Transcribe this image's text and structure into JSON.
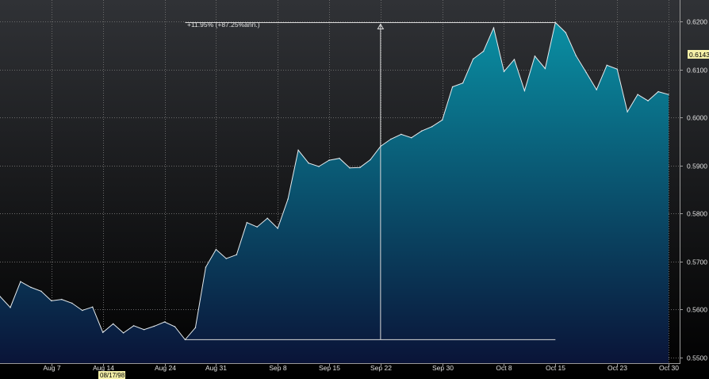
{
  "chart_data": {
    "type": "area",
    "annotation": "+11.95% (+87.25%ann.)",
    "last_value_label": "0.6143",
    "cursor_date_label": "08/17/98",
    "ylim": [
      0.5455,
      0.6245
    ],
    "yticks": [
      0.55,
      0.56,
      0.57,
      0.58,
      0.59,
      0.6,
      0.61,
      0.62
    ],
    "ytick_labels": [
      "0.5500",
      "0.5600",
      "0.5700",
      "0.5800",
      "0.5900",
      "0.6000",
      "0.6100",
      "0.6200"
    ],
    "xtick_labels": [
      "Aug 7",
      "Aug 14",
      "Aug 24",
      "Aug 31",
      "Sep 8",
      "Sep 15",
      "Sep 22",
      "Sep 30",
      "Oct 8",
      "Oct 15",
      "Oct 23",
      "Oct 30"
    ],
    "xtick_index": [
      5,
      10,
      16,
      21,
      27,
      32,
      37,
      43,
      49,
      54,
      60,
      65
    ],
    "values": [
      0.5627,
      0.5604,
      0.5658,
      0.5646,
      0.5638,
      0.5618,
      0.5621,
      0.5613,
      0.5598,
      0.5605,
      0.5552,
      0.557,
      0.5551,
      0.5566,
      0.5558,
      0.5565,
      0.5574,
      0.5564,
      0.5537,
      0.5562,
      0.5688,
      0.5725,
      0.5706,
      0.5714,
      0.5781,
      0.5772,
      0.579,
      0.5769,
      0.583,
      0.5932,
      0.5905,
      0.5898,
      0.5911,
      0.5915,
      0.5895,
      0.5896,
      0.5912,
      0.594,
      0.5955,
      0.5965,
      0.5958,
      0.5972,
      0.5981,
      0.5995,
      0.6064,
      0.6072,
      0.6122,
      0.6138,
      0.6187,
      0.6096,
      0.6121,
      0.6056,
      0.6128,
      0.6102,
      0.6198,
      0.6177,
      0.6129,
      0.6094,
      0.6058,
      0.6109,
      0.6101,
      0.6012,
      0.6048,
      0.6035,
      0.6054,
      0.6048
    ],
    "measure": {
      "from_index": 18,
      "to_index": 54,
      "from_value": 0.5537,
      "to_value": 0.6198
    },
    "grid": true,
    "colors": {
      "background_top": "#303236",
      "background_bottom": "#000000",
      "fill_top": "#0a8fa3",
      "fill_bottom": "#0a1438",
      "line": "#e6ecef",
      "grid": "#6a6a6a",
      "tick_text": "#e0e0e0",
      "price_tag": "#f4f0a8"
    }
  }
}
